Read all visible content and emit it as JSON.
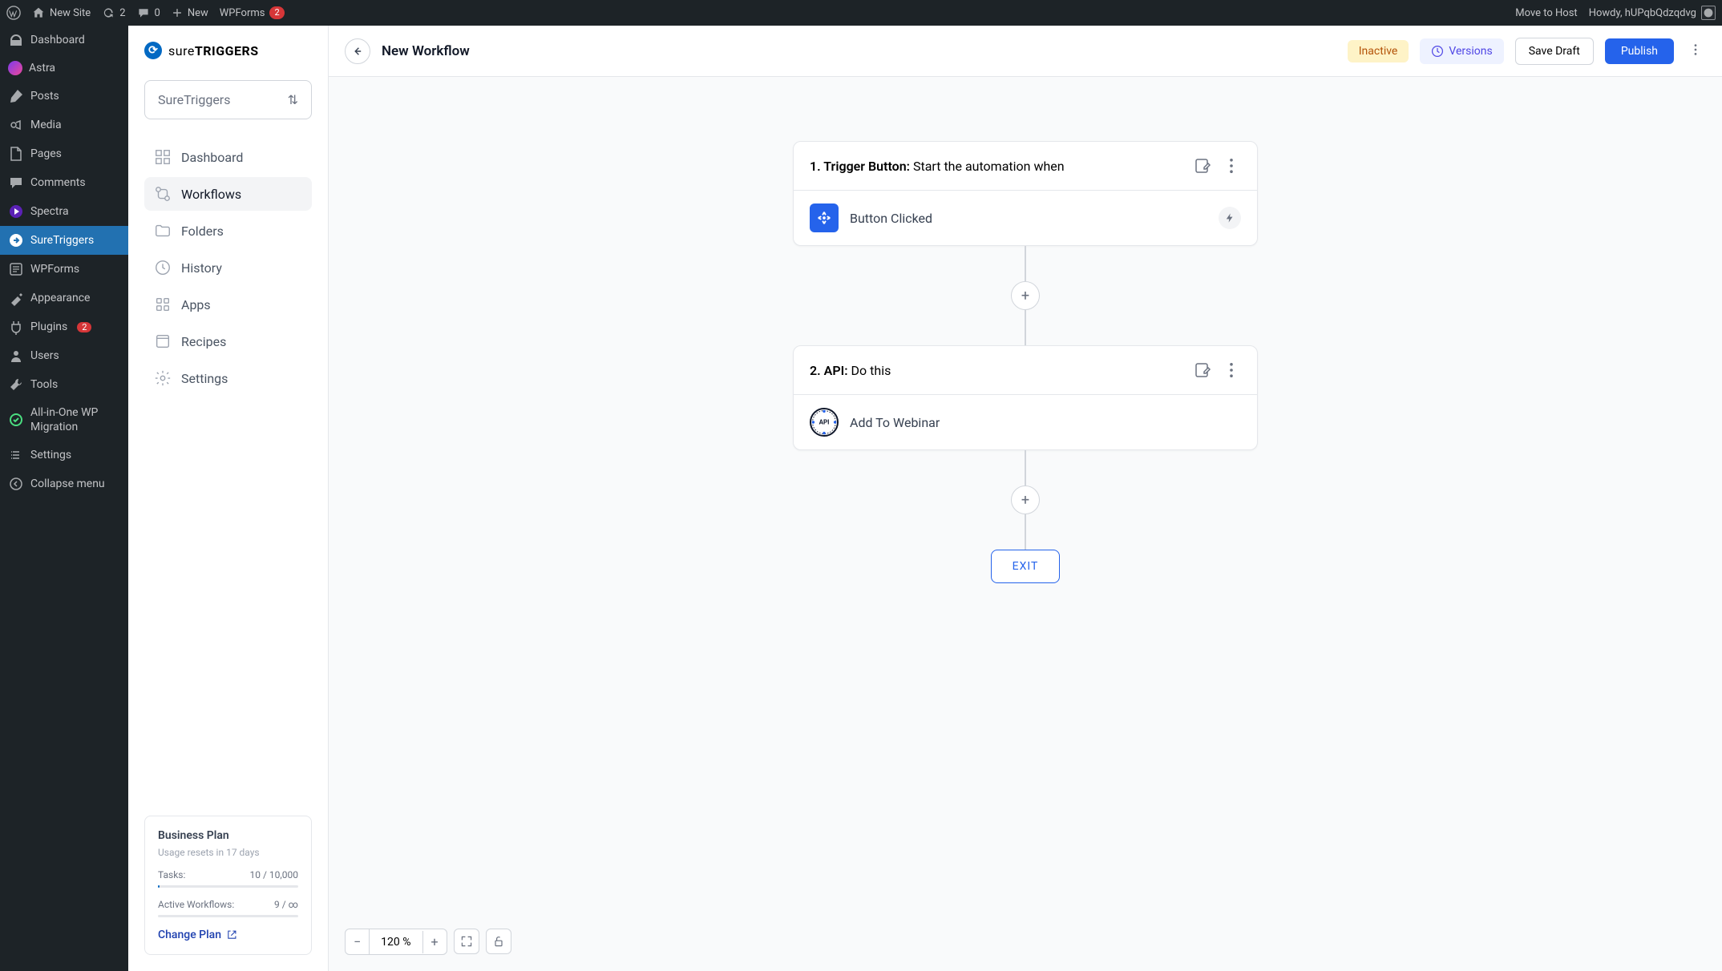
{
  "wpbar": {
    "site": "New Site",
    "refresh_count": "2",
    "comment_count": "0",
    "new": "New",
    "wpforms": "WPForms",
    "wpforms_count": "2",
    "move_host": "Move to Host",
    "greeting": "Howdy, hUPqbQdzqdvg"
  },
  "wpmenu": {
    "dashboard": "Dashboard",
    "astra": "Astra",
    "posts": "Posts",
    "media": "Media",
    "pages": "Pages",
    "comments": "Comments",
    "spectra": "Spectra",
    "suretriggers": "SureTriggers",
    "wpforms": "WPForms",
    "appearance": "Appearance",
    "plugins": "Plugins",
    "plugins_count": "2",
    "users": "Users",
    "tools": "Tools",
    "migration": "All-in-One WP Migration",
    "settings": "Settings",
    "collapse": "Collapse menu"
  },
  "st": {
    "brand1": "sure",
    "brand2": "TRIGGERS",
    "dropdown": "SureTriggers",
    "nav": {
      "dashboard": "Dashboard",
      "workflows": "Workflows",
      "folders": "Folders",
      "history": "History",
      "apps": "Apps",
      "recipes": "Recipes",
      "settings": "Settings"
    },
    "plan": {
      "title": "Business Plan",
      "sub": "Usage resets in 17 days",
      "tasks_label": "Tasks:",
      "tasks_value": "10 / 10,000",
      "workflows_label": "Active Workflows:",
      "workflows_value": "9 / ∞",
      "change": "Change Plan"
    }
  },
  "topbar": {
    "title": "New Workflow",
    "status": "Inactive",
    "versions": "Versions",
    "draft": "Save Draft",
    "publish": "Publish"
  },
  "cards": {
    "trigger": {
      "header_bold": "1. Trigger Button:",
      "header_text": " Start the automation when",
      "body": "Button Clicked"
    },
    "api": {
      "header_bold": "2. API:",
      "header_text": " Do this",
      "body": "Add To Webinar"
    }
  },
  "exit": "EXIT",
  "zoom": "120 %"
}
